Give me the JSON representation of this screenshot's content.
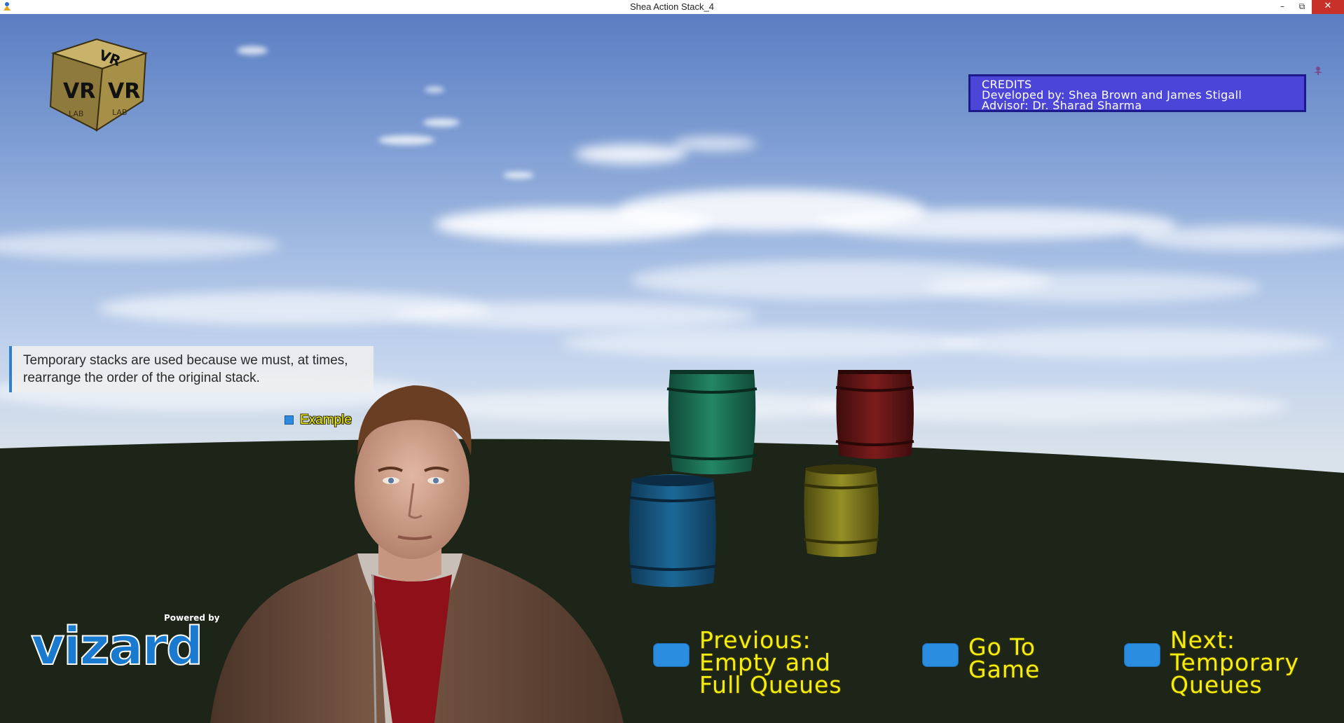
{
  "window": {
    "title": "Shea Action Stack_4",
    "minimize_glyph": "–",
    "restore_glyph": "⧉",
    "close_glyph": "✕"
  },
  "credits": {
    "heading": "CREDITS",
    "developed_by": "Developed by: Shea Brown and James Stigall",
    "advisor": "Advisor: Dr. Sharad Sharma"
  },
  "dialog": {
    "lines": [
      "Temporary stacks are used because we must, at times,",
      "rearrange the order of the original stack."
    ],
    "option_label": "Example"
  },
  "logos": {
    "vr_cube": [
      "VR",
      "LAB"
    ],
    "powered_by": "Powered by",
    "vizard": "vizard"
  },
  "navigation": {
    "previous": [
      "Previous:",
      "Empty and",
      "Full Queues"
    ],
    "go_to_game": [
      "Go To",
      "Game"
    ],
    "next": [
      "Next:",
      "Temporary",
      "Queues"
    ]
  },
  "colors": {
    "credits_bg": "#4b46d8",
    "option_text": "#f4ee10",
    "option_button": "#2b8de0",
    "ground": "#1d2418",
    "barrel_green": "#1e7a5c",
    "barrel_red": "#7a1a1a",
    "barrel_blue": "#1b5f8c",
    "barrel_yellow": "#8a8520"
  },
  "icons": {
    "app": "vizard-app-icon",
    "credit_marker": "avatar-marker-icon"
  }
}
